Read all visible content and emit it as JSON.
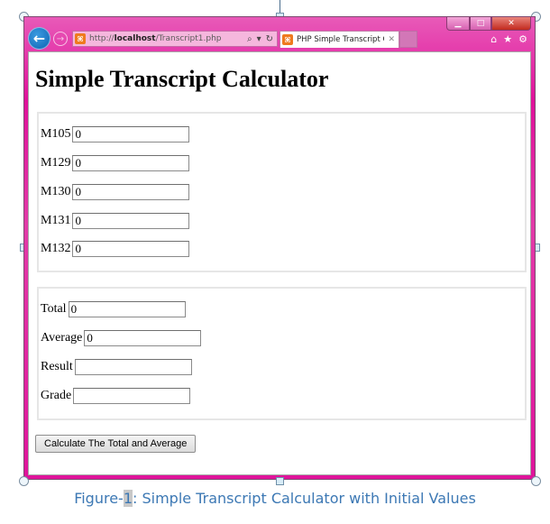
{
  "browser": {
    "address_url_prefix": "http://",
    "address_url_host": "localhost",
    "address_url_path": "/Transcript1.php",
    "tab_title": "PHP Simple Transcript Calc...",
    "icons": {
      "back": "←",
      "forward": "→",
      "search": "⌕",
      "dropdown": "▾",
      "refresh": "↻",
      "tab_close": "✕",
      "home": "⌂",
      "favorites": "★",
      "settings": "⚙",
      "minimize": "▁",
      "maximize": "□",
      "close": "✕",
      "favicon": "⌘"
    }
  },
  "page": {
    "title": "Simple Transcript Calculator",
    "courses": [
      {
        "label": "M105",
        "value": "0"
      },
      {
        "label": "M129",
        "value": "0"
      },
      {
        "label": "M130",
        "value": "0"
      },
      {
        "label": "M131",
        "value": "0"
      },
      {
        "label": "M132",
        "value": "0"
      }
    ],
    "results": [
      {
        "label": "Total",
        "value": "0"
      },
      {
        "label": "Average",
        "value": "0"
      },
      {
        "label": "Result",
        "value": ""
      },
      {
        "label": "Grade",
        "value": ""
      }
    ],
    "calculate_button": "Calculate The Total and Average"
  },
  "caption": {
    "prefix": "Figure-",
    "number": "1",
    "text": ": Simple Transcript Calculator with Initial Values",
    "color": "#3c78b4"
  }
}
